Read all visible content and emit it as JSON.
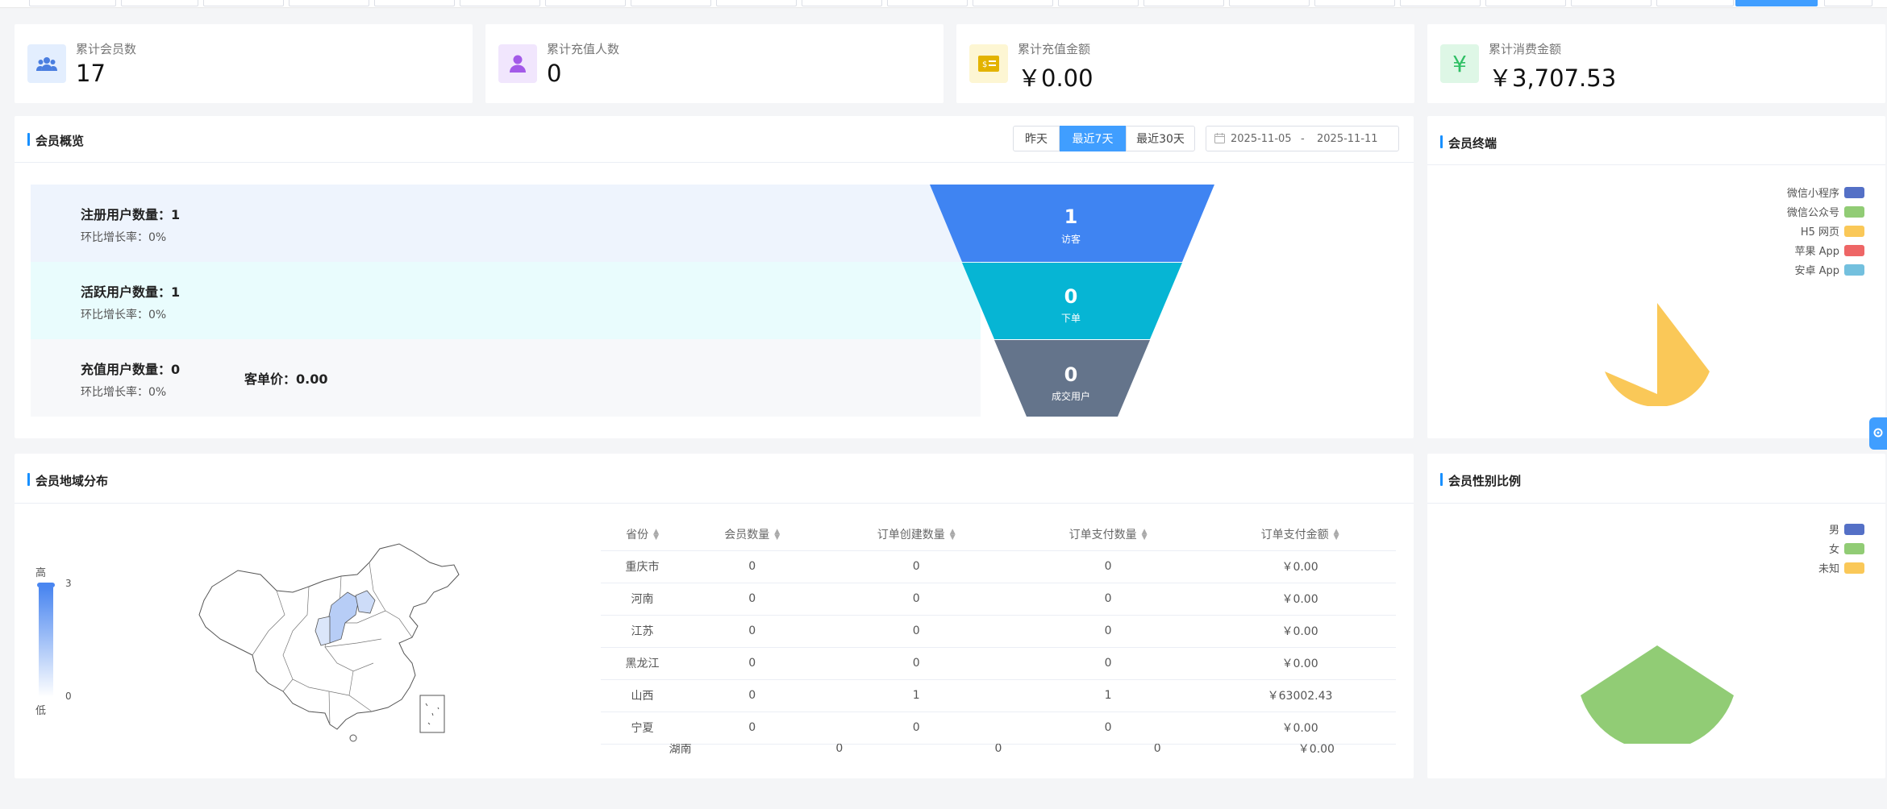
{
  "stats": [
    {
      "label": "累计会员数",
      "value": "17",
      "icon": "users-icon",
      "bg": "#e3eefe",
      "fg": "#4a7ee0"
    },
    {
      "label": "累计充值人数",
      "value": "0",
      "icon": "user-icon",
      "bg": "#f1e6fd",
      "fg": "#a35ae8"
    },
    {
      "label": "累计充值金额",
      "value": "￥0.00",
      "icon": "money-card-icon",
      "bg": "#fdf6d3",
      "fg": "#e3b300"
    },
    {
      "label": "累计消费金额",
      "value": "￥3,707.53",
      "icon": "yen-icon",
      "bg": "#def7e6",
      "fg": "#2fbf64"
    }
  ],
  "overview": {
    "title": "会员概览",
    "ranges": [
      "昨天",
      "最近7天",
      "最近30天"
    ],
    "active_range": "最近7天",
    "date_start": "2025-11-05",
    "date_sep": "-",
    "date_end": "2025-11-11",
    "rows": [
      {
        "title": "注册用户数量：1",
        "growth": "环比增长率：0%"
      },
      {
        "title": "活跃用户数量：1",
        "growth": "环比增长率：0%"
      },
      {
        "title": "充值用户数量：0",
        "growth": "环比增长率：0%",
        "extra": "客单价：0.00"
      }
    ],
    "funnel": [
      {
        "value": "1",
        "label": "访客",
        "color": "#3f84f2"
      },
      {
        "value": "0",
        "label": "下单",
        "color": "#06b5d4"
      },
      {
        "value": "0",
        "label": "成交用户",
        "color": "#64748b"
      }
    ]
  },
  "terminal": {
    "title": "会员终端",
    "legend": [
      {
        "name": "微信小程序",
        "color": "#5470c6"
      },
      {
        "name": "微信公众号",
        "color": "#91cc75"
      },
      {
        "name": "H5 网页",
        "color": "#fac858"
      },
      {
        "name": "苹果 App",
        "color": "#ee6666"
      },
      {
        "name": "安卓 App",
        "color": "#73c0de"
      }
    ]
  },
  "region": {
    "title": "会员地域分布",
    "scale_high": "高",
    "scale_low": "低",
    "scale_max": "3",
    "scale_min": "0",
    "columns": [
      "省份",
      "会员数量",
      "订单创建数量",
      "订单支付数量",
      "订单支付金额"
    ],
    "rows": [
      [
        "重庆市",
        "0",
        "0",
        "0",
        "￥0.00"
      ],
      [
        "河南",
        "0",
        "0",
        "0",
        "￥0.00"
      ],
      [
        "江苏",
        "0",
        "0",
        "0",
        "￥0.00"
      ],
      [
        "黑龙江",
        "0",
        "0",
        "0",
        "￥0.00"
      ],
      [
        "山西",
        "0",
        "1",
        "1",
        "￥63002.43"
      ],
      [
        "宁夏",
        "0",
        "0",
        "0",
        "￥0.00"
      ],
      [
        "湖南",
        "0",
        "0",
        "0",
        "￥0.00"
      ]
    ]
  },
  "gender": {
    "title": "会员性别比例",
    "legend": [
      {
        "name": "男",
        "color": "#5470c6"
      },
      {
        "name": "女",
        "color": "#91cc75"
      },
      {
        "name": "未知",
        "color": "#fac858"
      }
    ]
  }
}
